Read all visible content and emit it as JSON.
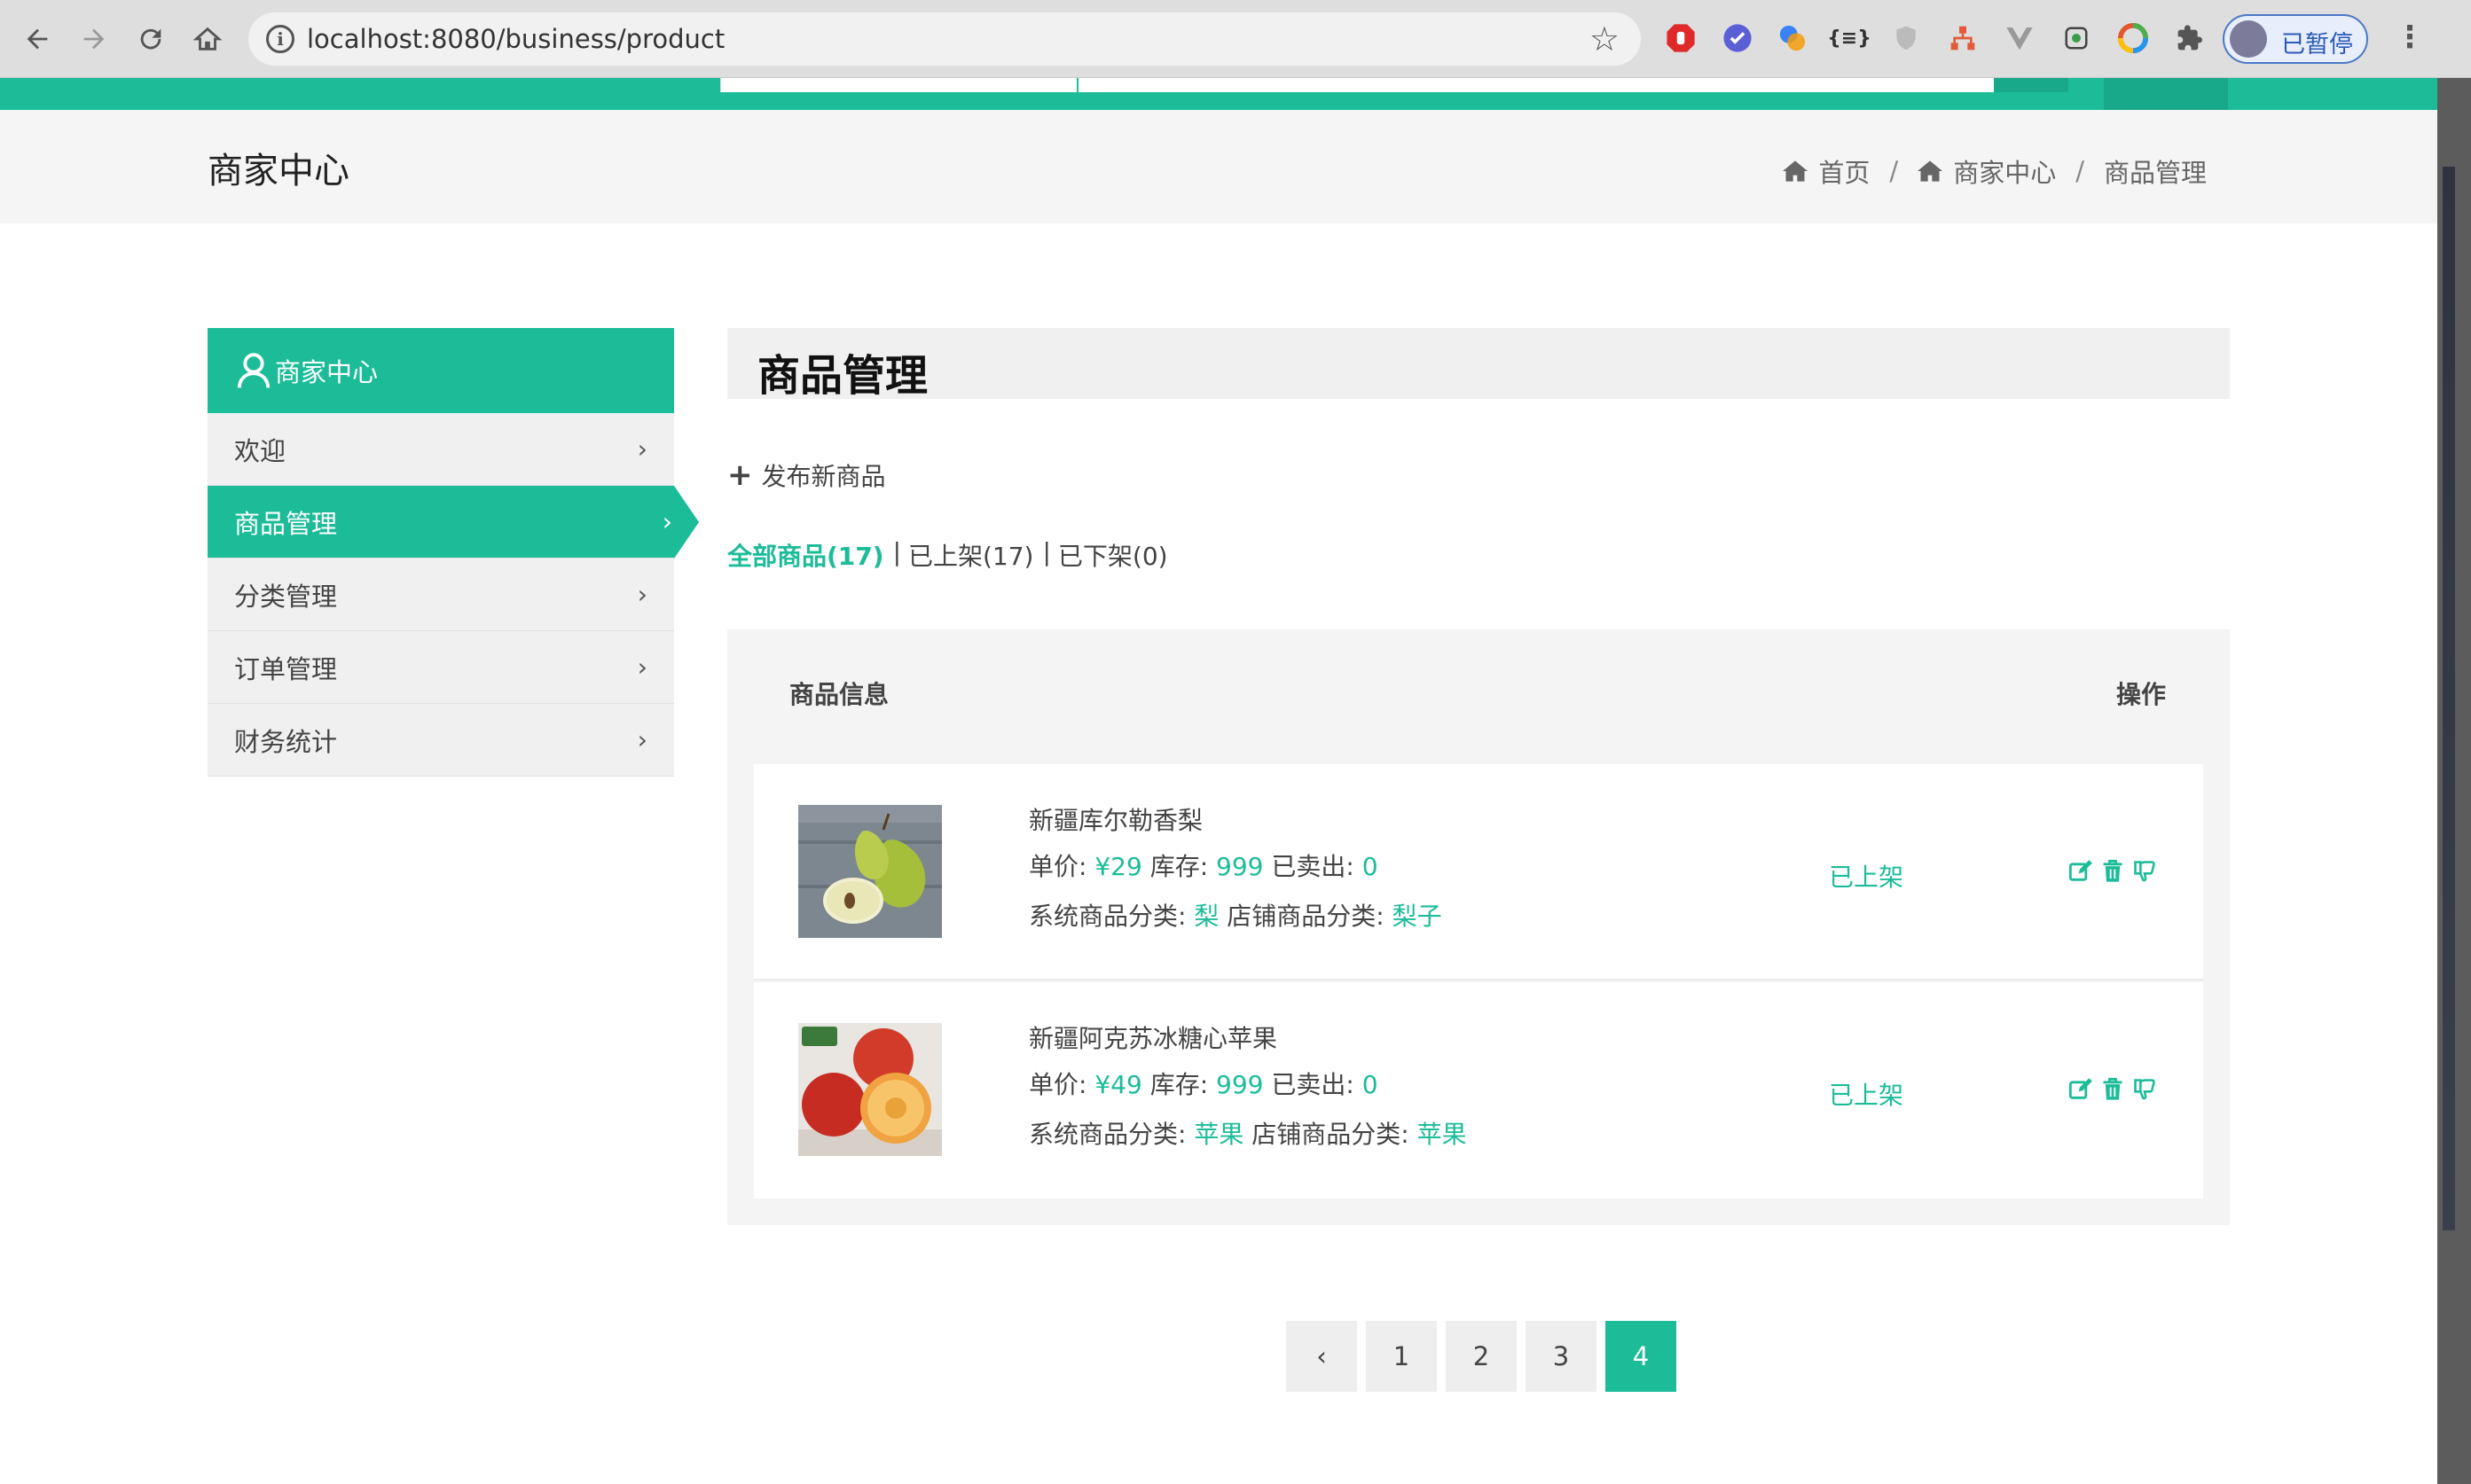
{
  "browser": {
    "url": "localhost:8080/business/product",
    "profile_label": "已暂停",
    "info_glyph": "i"
  },
  "site": {
    "band_title": "商家中心",
    "breadcrumb": [
      "首页",
      "商家中心",
      "商品管理"
    ],
    "breadcrumb_sep": "/"
  },
  "sidebar": {
    "header": "商家中心",
    "items": [
      {
        "label": "欢迎"
      },
      {
        "label": "商品管理"
      },
      {
        "label": "分类管理"
      },
      {
        "label": "订单管理"
      },
      {
        "label": "财务统计"
      }
    ],
    "active_index": 1
  },
  "main": {
    "title": "商品管理",
    "publish_label": "发布新商品",
    "filters": [
      "全部商品(17)",
      "已上架(17)",
      "已下架(0)"
    ],
    "filter_separator": "|",
    "table": {
      "col_info": "商品信息",
      "col_ops": "操作",
      "rows": [
        {
          "name": "新疆库尔勒香梨",
          "price_label": "单价:",
          "price": "¥29",
          "stock_label": "库存:",
          "stock": "999",
          "sold_label": "已卖出:",
          "sold": "0",
          "sys_cat_label": "系统商品分类:",
          "sys_cat": "梨",
          "shop_cat_label": "店铺商品分类:",
          "shop_cat": "梨子",
          "status": "已上架",
          "image": "pear-photo"
        },
        {
          "name": "新疆阿克苏冰糖心苹果",
          "price_label": "单价:",
          "price": "¥49",
          "stock_label": "库存:",
          "stock": "999",
          "sold_label": "已卖出:",
          "sold": "0",
          "sys_cat_label": "系统商品分类:",
          "sys_cat": "苹果",
          "shop_cat_label": "店铺商品分类:",
          "shop_cat": "苹果",
          "status": "已上架",
          "image": "apple-photo"
        }
      ]
    }
  },
  "pagination": {
    "prev": "‹",
    "pages": [
      "1",
      "2",
      "3",
      "4"
    ],
    "current": "4"
  },
  "colors": {
    "accent": "#1cbc99",
    "panel": "#f0f0f0"
  }
}
